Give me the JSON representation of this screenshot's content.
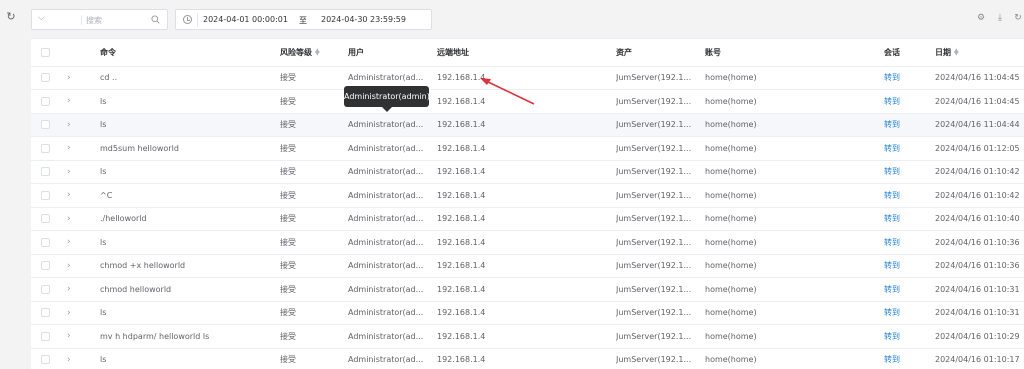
{
  "toolbar": {
    "search_placeholder": "搜索",
    "date_start": "2024-04-01 00:00:01",
    "date_sep": "至",
    "date_end": "2024-04-30 23:59:59",
    "icons": [
      "refresh-icon",
      "settings-icon",
      "download-icon",
      "reload-icon"
    ]
  },
  "table": {
    "headers": {
      "command": "命令",
      "risk": "风险等级",
      "user": "用户",
      "remote": "远端地址",
      "asset": "资产",
      "account": "账号",
      "session": "会话",
      "date": "日期"
    },
    "rows": [
      {
        "command": "cd ..",
        "risk": "接受",
        "user": "Administrator(ad...",
        "remote": "192.168.1.4",
        "asset": "JumServer(192.1...",
        "account": "home(home)",
        "session": "转到",
        "date": "2024/04/16 11:04:45"
      },
      {
        "command": "ls",
        "risk": "接受",
        "user": "Administrator(ad...",
        "remote": "192.168.1.4",
        "asset": "JumServer(192.1...",
        "account": "home(home)",
        "session": "转到",
        "date": "2024/04/16 11:04:45"
      },
      {
        "command": "ls",
        "risk": "接受",
        "user": "Administrator(ad...",
        "remote": "192.168.1.4",
        "asset": "JumServer(192.1...",
        "account": "home(home)",
        "session": "转到",
        "date": "2024/04/16 11:04:44"
      },
      {
        "command": "md5sum helloworld",
        "risk": "接受",
        "user": "Administrator(ad...",
        "remote": "192.168.1.4",
        "asset": "JumServer(192.1...",
        "account": "home(home)",
        "session": "转到",
        "date": "2024/04/16 01:12:05"
      },
      {
        "command": "ls",
        "risk": "接受",
        "user": "Administrator(ad...",
        "remote": "192.168.1.4",
        "asset": "JumServer(192.1...",
        "account": "home(home)",
        "session": "转到",
        "date": "2024/04/16 01:10:42"
      },
      {
        "command": "^C",
        "risk": "接受",
        "user": "Administrator(ad...",
        "remote": "192.168.1.4",
        "asset": "JumServer(192.1...",
        "account": "home(home)",
        "session": "转到",
        "date": "2024/04/16 01:10:42"
      },
      {
        "command": "./helloworld",
        "risk": "接受",
        "user": "Administrator(ad...",
        "remote": "192.168.1.4",
        "asset": "JumServer(192.1...",
        "account": "home(home)",
        "session": "转到",
        "date": "2024/04/16 01:10:40"
      },
      {
        "command": "ls",
        "risk": "接受",
        "user": "Administrator(ad...",
        "remote": "192.168.1.4",
        "asset": "JumServer(192.1...",
        "account": "home(home)",
        "session": "转到",
        "date": "2024/04/16 01:10:36"
      },
      {
        "command": "chmod +x helloworld",
        "risk": "接受",
        "user": "Administrator(ad...",
        "remote": "192.168.1.4",
        "asset": "JumServer(192.1...",
        "account": "home(home)",
        "session": "转到",
        "date": "2024/04/16 01:10:36"
      },
      {
        "command": "chmod helloworld",
        "risk": "接受",
        "user": "Administrator(ad...",
        "remote": "192.168.1.4",
        "asset": "JumServer(192.1...",
        "account": "home(home)",
        "session": "转到",
        "date": "2024/04/16 01:10:31"
      },
      {
        "command": "ls",
        "risk": "接受",
        "user": "Administrator(ad...",
        "remote": "192.168.1.4",
        "asset": "JumServer(192.1...",
        "account": "home(home)",
        "session": "转到",
        "date": "2024/04/16 01:10:31"
      },
      {
        "command": "mv h hdparm/ helloworld ls",
        "risk": "接受",
        "user": "Administrator(ad...",
        "remote": "192.168.1.4",
        "asset": "JumServer(192.1...",
        "account": "home(home)",
        "session": "转到",
        "date": "2024/04/16 01:10:29"
      },
      {
        "command": "ls",
        "risk": "接受",
        "user": "Administrator(ad...",
        "remote": "192.168.1.4",
        "asset": "JumServer(192.1...",
        "account": "home(home)",
        "session": "转到",
        "date": "2024/04/16 01:10:17"
      }
    ]
  },
  "tooltip": {
    "text": "Administrator(admin)"
  },
  "colors": {
    "link": "#1f7fd6",
    "annotation_arrow": "#e0313b"
  }
}
